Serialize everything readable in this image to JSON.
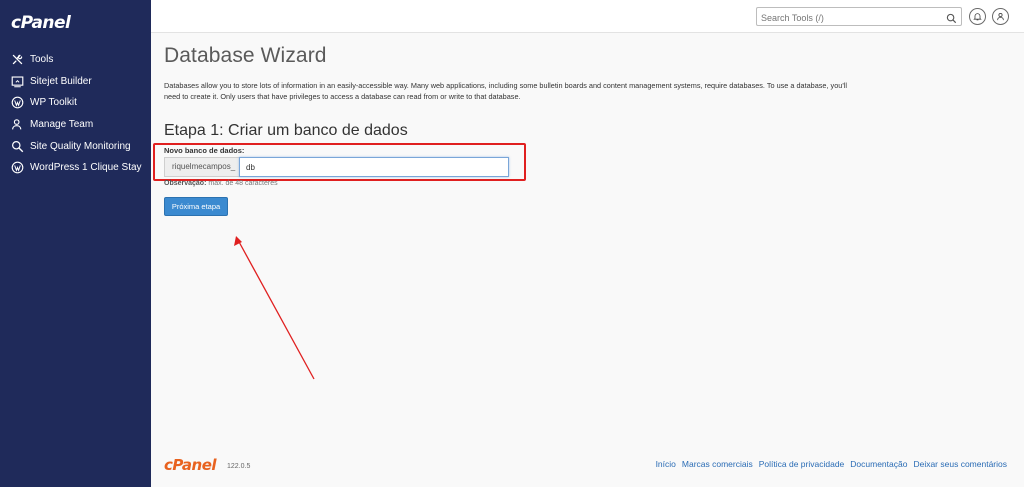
{
  "sidebar": {
    "logo": "cPanel",
    "items": [
      {
        "label": "Tools",
        "icon": "tools-icon"
      },
      {
        "label": "Sitejet Builder",
        "icon": "sitejet-icon"
      },
      {
        "label": "WP Toolkit",
        "icon": "wordpress-icon"
      },
      {
        "label": "Manage Team",
        "icon": "team-icon"
      },
      {
        "label": "Site Quality Monitoring",
        "icon": "monitoring-icon"
      },
      {
        "label": "WordPress 1 Clique Stay",
        "icon": "wordpress-icon"
      }
    ]
  },
  "topbar": {
    "search_placeholder": "Search Tools (/)"
  },
  "main": {
    "title": "Database Wizard",
    "description": "Databases allow you to store lots of information in an easily-accessible way. Many web applications, including some bulletin boards and content management systems, require databases. To use a database, you'll need to create it. Only users that have privileges to access a database can read from or write to that database.",
    "step_title": "Etapa 1: Criar um banco de dados",
    "field_label": "Novo banco de dados:",
    "prefix": "riquelmecampos_",
    "input_value": "db",
    "note_label": "Observação:",
    "note_text": " máx. de 48 caracteres",
    "next_button": "Próxima etapa"
  },
  "footer": {
    "logo": "cPanel",
    "version": "122.0.5",
    "links": [
      "Início",
      "Marcas comerciais",
      "Política de privacidade",
      "Documentação",
      "Deixar seus comentários"
    ]
  },
  "colors": {
    "sidebar_bg": "#1f2a5a",
    "primary_button": "#3b8ad0",
    "highlight": "#e02020",
    "footer_logo": "#e8621f",
    "link": "#2a6cb5"
  }
}
